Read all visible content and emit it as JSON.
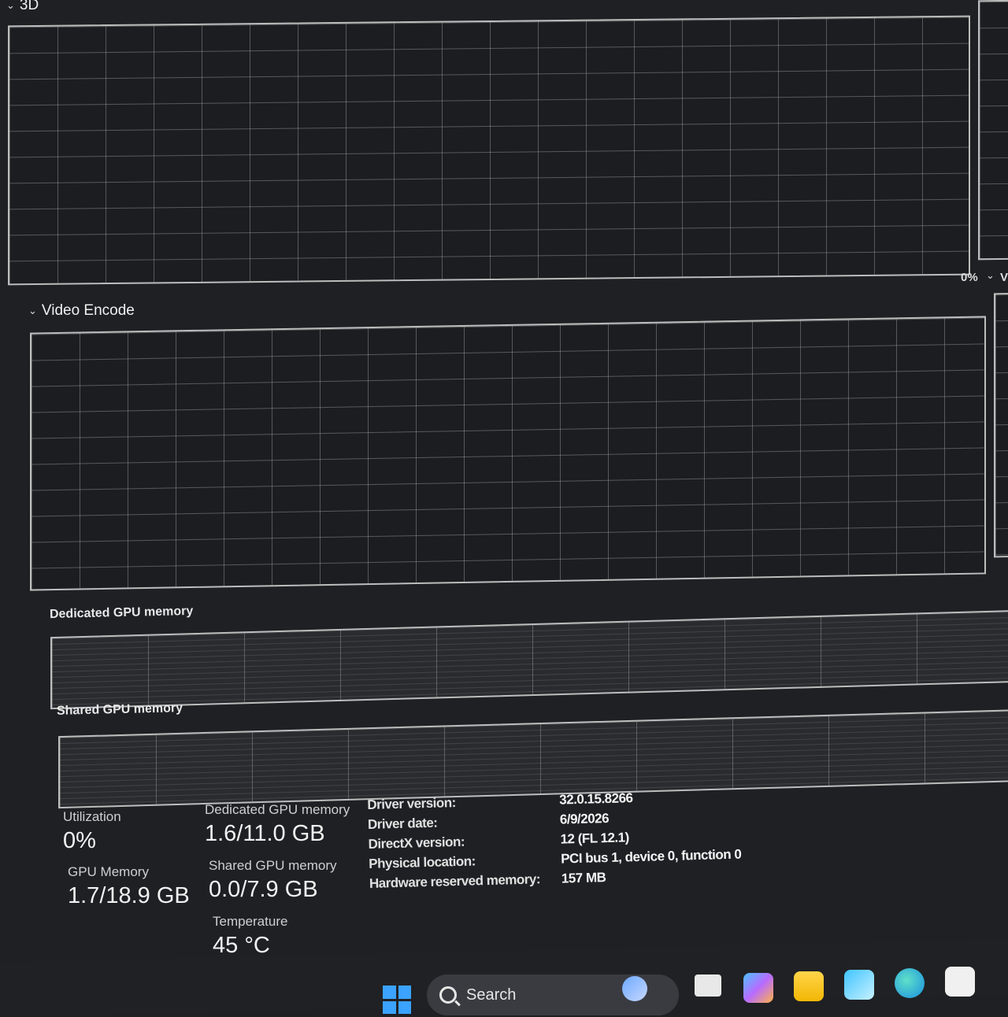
{
  "sections": {
    "three_d": {
      "label": "3D"
    },
    "video_encode": {
      "label": "Video Encode"
    },
    "side_percent": "0%",
    "side_label": "V"
  },
  "memory_graphs": {
    "dedicated_label": "Dedicated GPU memory",
    "shared_label": "Shared GPU memory"
  },
  "stats": {
    "utilization": {
      "label": "Utilization",
      "value": "0%"
    },
    "gpu_memory": {
      "label": "GPU Memory",
      "value": "1.7/18.9 GB"
    },
    "dedicated": {
      "label": "Dedicated GPU memory",
      "value": "1.6/11.0 GB"
    },
    "shared": {
      "label": "Shared GPU memory",
      "value": "0.0/7.9 GB"
    },
    "temperature": {
      "label": "Temperature",
      "value": "45 °C"
    }
  },
  "info": [
    {
      "key": "Driver version:",
      "value": "32.0.15.8266"
    },
    {
      "key": "Driver date:",
      "value": "6/9/2026"
    },
    {
      "key": "DirectX version:",
      "value": "12 (FL 12.1)"
    },
    {
      "key": "Physical location:",
      "value": "PCI bus 1, device 0, function 0"
    },
    {
      "key": "Hardware reserved memory:",
      "value": "157 MB"
    }
  ],
  "taskbar": {
    "search_label": "Search",
    "icons": [
      "start-icon",
      "widgets-icon",
      "task-view-icon",
      "copilot-icon",
      "file-explorer-icon",
      "store-icon",
      "edge-icon",
      "app-icon"
    ],
    "accent": "#3ba3ff"
  }
}
